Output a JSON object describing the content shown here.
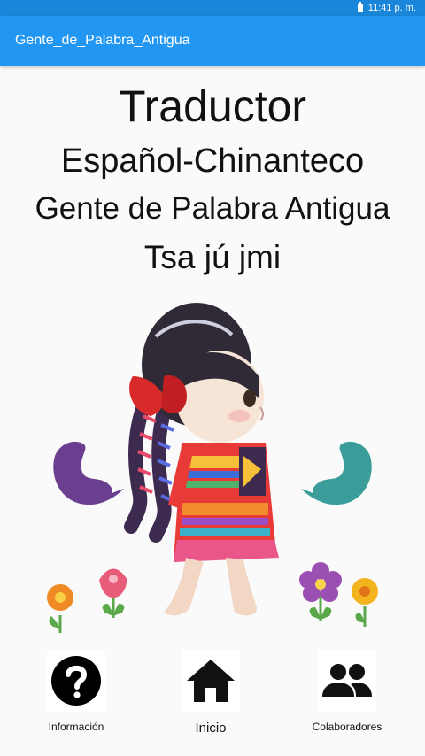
{
  "status_bar": {
    "time": "11:41 p. m.",
    "battery_icon": "battery-icon"
  },
  "app_bar": {
    "title": "Gente_de_Palabra_Antigua",
    "color": "#2196f3"
  },
  "header": {
    "line1": "Traductor",
    "line2": "Español-Chinanteco",
    "line3": "Gente de Palabra Antigua",
    "line4": "Tsa jú jmi"
  },
  "illustration": {
    "description_icon": "girl-illustration"
  },
  "bottom_nav": [
    {
      "label": "Información",
      "icon": "question-icon"
    },
    {
      "label": "Inicio",
      "icon": "home-icon"
    },
    {
      "label": "Colaboradores",
      "icon": "people-icon"
    }
  ]
}
